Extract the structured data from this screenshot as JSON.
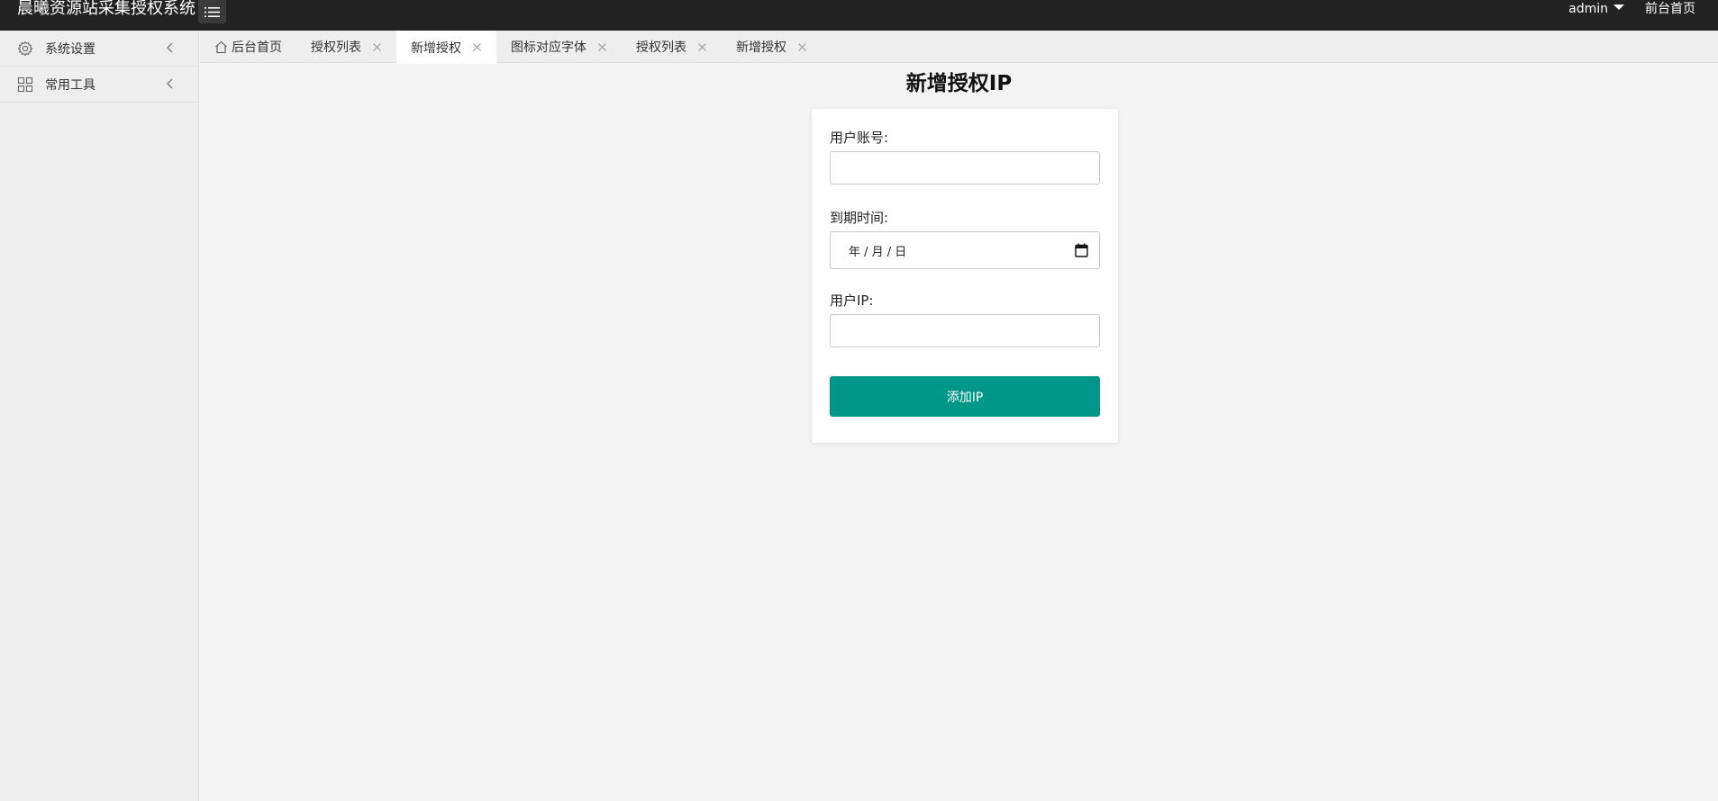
{
  "header": {
    "app_title": "晨曦资源站采集授权系统",
    "user_name": "admin",
    "front_link": "前台首页"
  },
  "sidebar": {
    "items": [
      {
        "label": "系统设置",
        "icon": "gear-icon"
      },
      {
        "label": "常用工具",
        "icon": "grid-icon"
      }
    ]
  },
  "tabs": [
    {
      "label": "后台首页",
      "icon": "home-icon",
      "closable": false,
      "active": false
    },
    {
      "label": "授权列表",
      "closable": true,
      "active": false
    },
    {
      "label": "新增授权",
      "closable": true,
      "active": true
    },
    {
      "label": "图标对应字体",
      "closable": true,
      "active": false
    },
    {
      "label": "授权列表",
      "closable": true,
      "active": false
    },
    {
      "label": "新增授权",
      "closable": true,
      "active": false
    }
  ],
  "form": {
    "title": "新增授权IP",
    "account_label": "用户账号:",
    "account_value": "",
    "expire_label": "到期时间:",
    "expire_placeholder": "年  / 月 / 日",
    "ip_label": "用户IP:",
    "ip_value": "",
    "submit_label": "添加IP"
  },
  "colors": {
    "header_bg": "#222222",
    "accent": "#009688",
    "sidebar_bg": "#eeeeee",
    "content_bg": "#f3f3f3"
  }
}
